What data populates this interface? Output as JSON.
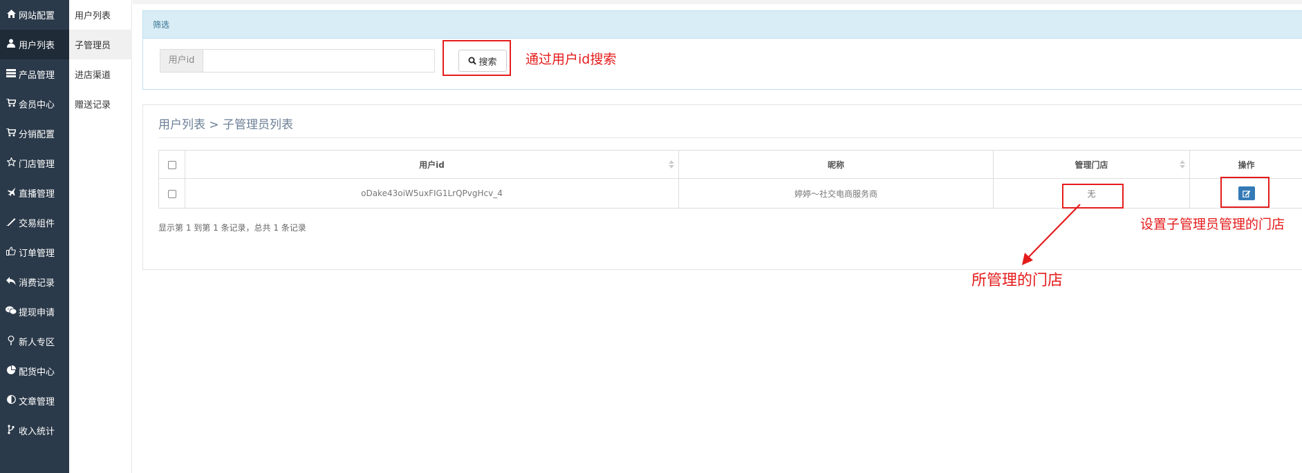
{
  "sidebar": {
    "items": [
      {
        "label": "网站配置",
        "icon": "home-icon"
      },
      {
        "label": "用户列表",
        "icon": "user-icon",
        "active": true
      },
      {
        "label": "产品管理",
        "icon": "server-icon"
      },
      {
        "label": "会员中心",
        "icon": "cart-icon"
      },
      {
        "label": "分销配置",
        "icon": "cart-icon"
      },
      {
        "label": "门店管理",
        "icon": "star-icon"
      },
      {
        "label": "直播管理",
        "icon": "plane-icon"
      },
      {
        "label": "交易组件",
        "icon": "pencil-icon"
      },
      {
        "label": "订单管理",
        "icon": "thumbs-up-icon"
      },
      {
        "label": "消费记录",
        "icon": "reply-icon"
      },
      {
        "label": "提现申请",
        "icon": "chat-icon"
      },
      {
        "label": "新人专区",
        "icon": "pin-icon"
      },
      {
        "label": "配货中心",
        "icon": "pie-chart-icon"
      },
      {
        "label": "文章管理",
        "icon": "contrast-icon"
      },
      {
        "label": "收入统计",
        "icon": "branch-icon"
      }
    ]
  },
  "subnav": {
    "items": [
      {
        "label": "用户列表"
      },
      {
        "label": "子管理员",
        "active": true
      },
      {
        "label": "进店渠道"
      },
      {
        "label": "赠送记录"
      }
    ]
  },
  "filter": {
    "heading": "筛选",
    "field_addon": "用户id",
    "field_value": "",
    "search_label": "搜索"
  },
  "list": {
    "breadcrumb": "用户列表 > 子管理员列表",
    "columns": [
      "用户id",
      "昵称",
      "管理门店",
      "操作"
    ],
    "rows": [
      {
        "user_id": "oDake43oiW5uxFIG1LrQPvgHcv_4",
        "nickname": "婷婷～社交电商服务商",
        "store": "无"
      }
    ],
    "paging": "显示第 1 到第 1 条记录，总共 1 条记录"
  },
  "annotations": {
    "search_note": "通过用户id搜索",
    "store_note": "所管理的门店",
    "action_note": "设置子管理员管理的门店",
    "color": "#e41b1b"
  },
  "colors": {
    "sidebar_bg": "#2b3a4a",
    "filter_head_bg": "#d9edf7",
    "primary_button": "#337ab7"
  }
}
